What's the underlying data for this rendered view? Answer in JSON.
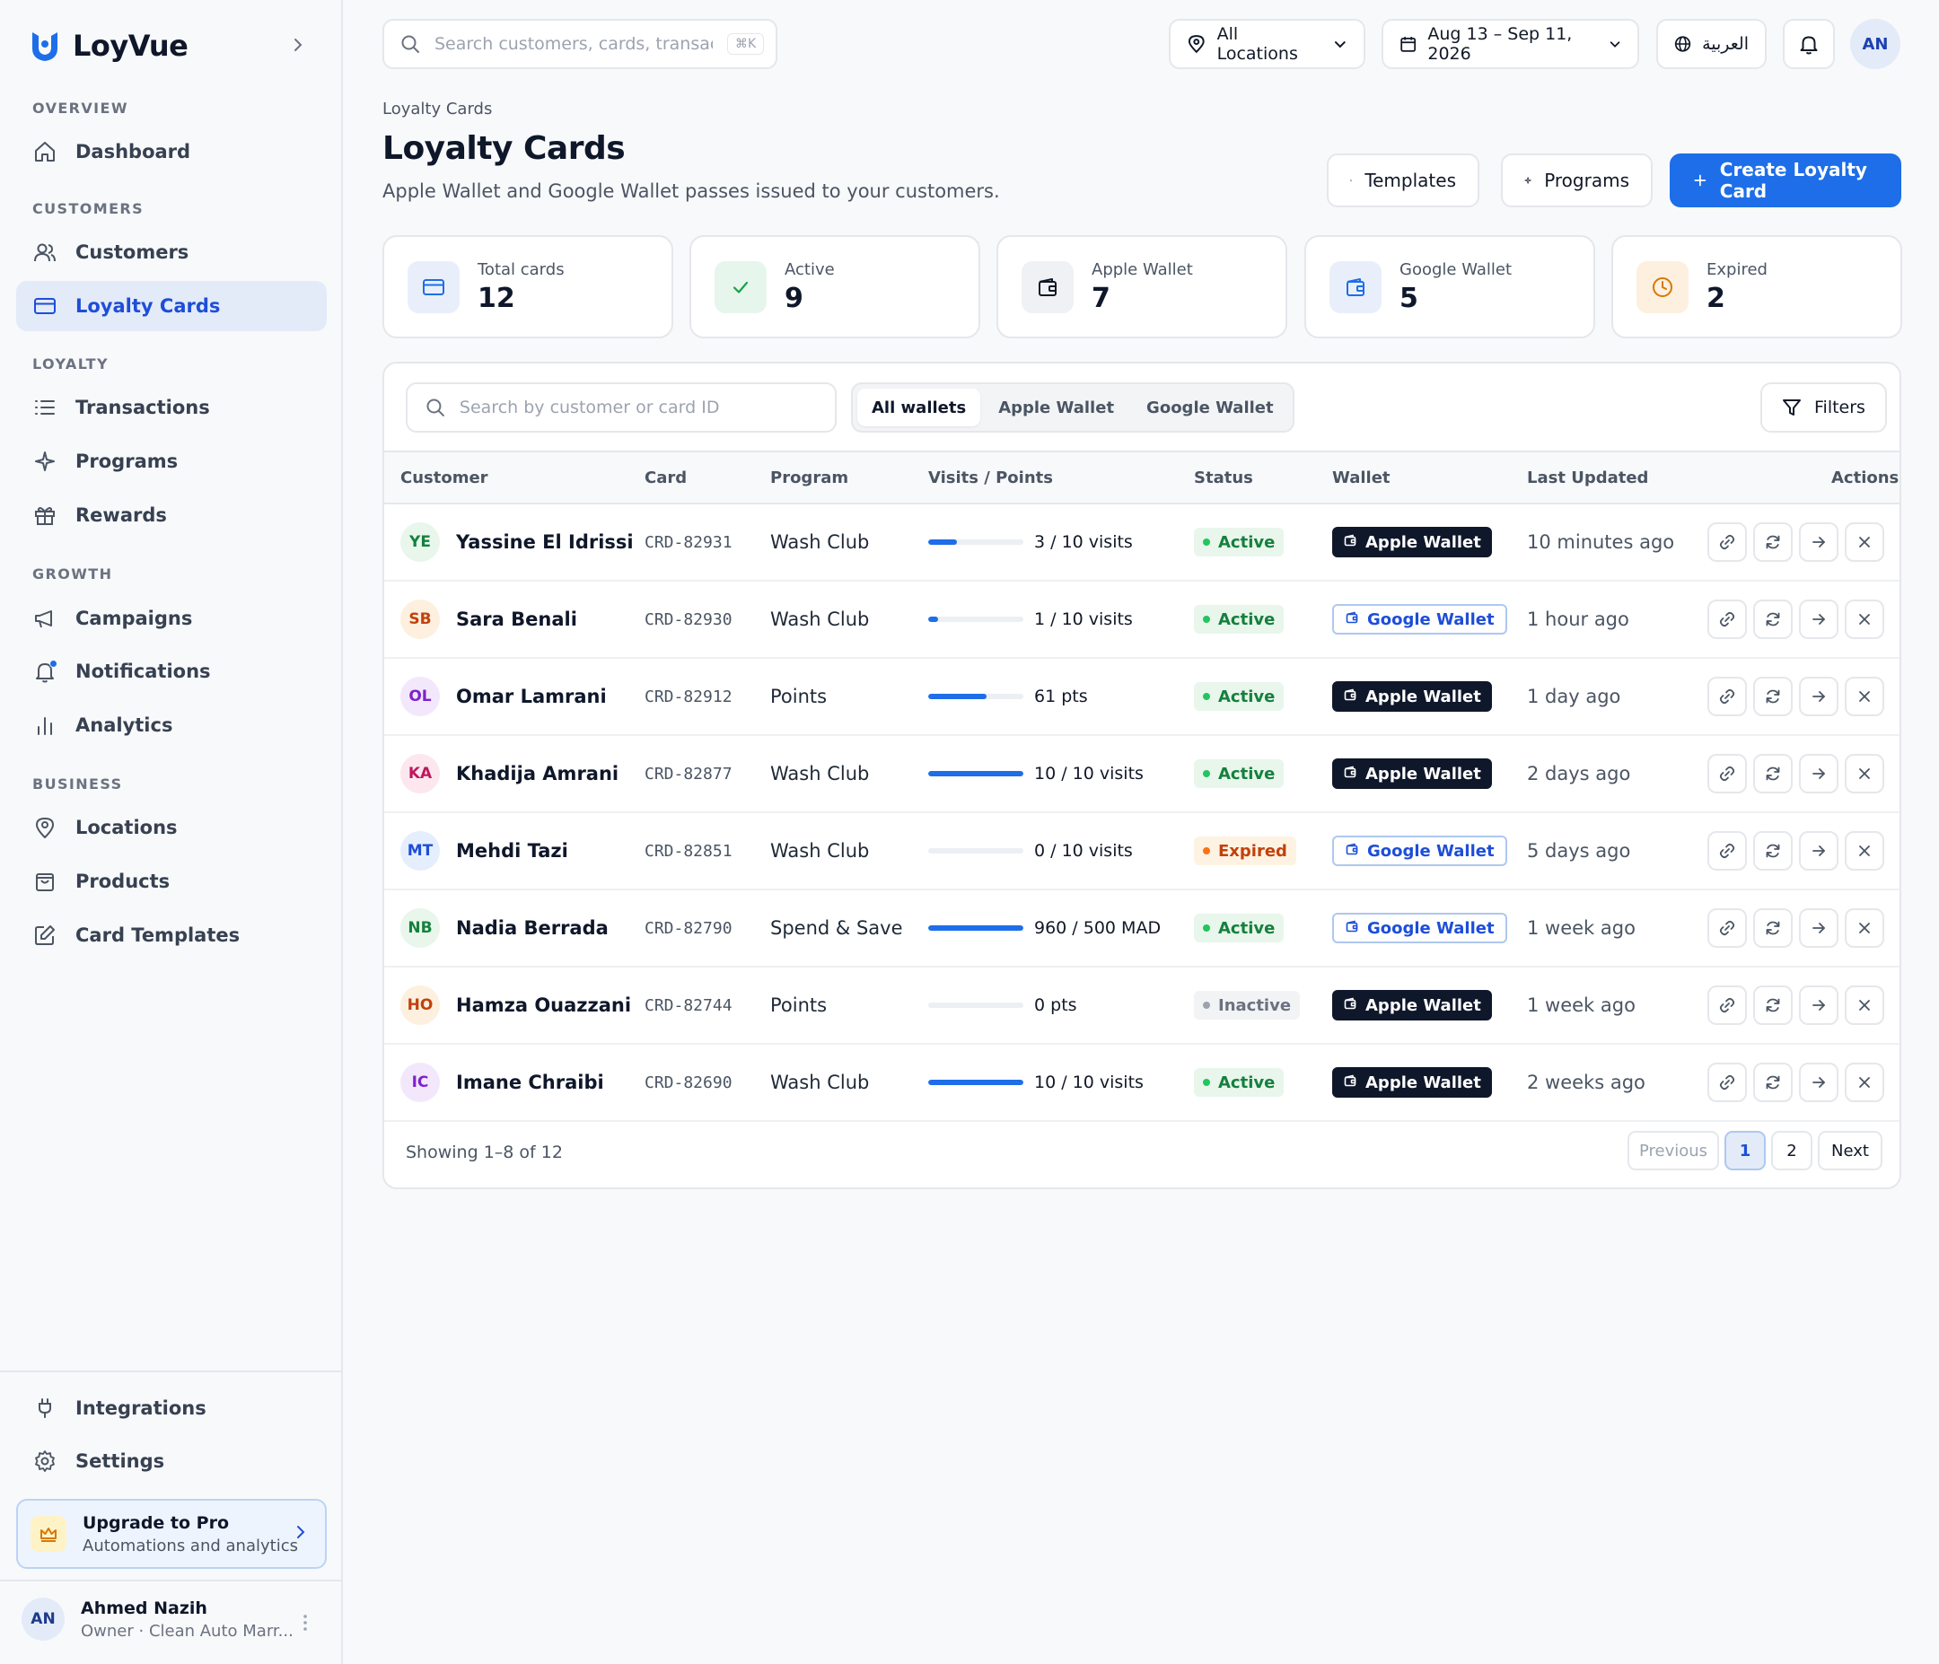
{
  "brand": {
    "name": "LoyVue"
  },
  "sidebar": {
    "sections": {
      "overview": "OVERVIEW",
      "customers": "CUSTOMERS",
      "loyalty": "LOYALTY",
      "growth": "GROWTH",
      "business": "BUSINESS"
    },
    "items": {
      "dashboard": "Dashboard",
      "customers": "Customers",
      "loyalty_cards": "Loyalty Cards",
      "transactions": "Transactions",
      "programs": "Programs",
      "rewards": "Rewards",
      "campaigns": "Campaigns",
      "notifications": "Notifications",
      "analytics": "Analytics",
      "locations": "Locations",
      "products": "Products",
      "card_templates": "Card Templates",
      "integrations": "Integrations",
      "settings": "Settings"
    },
    "active_item": "Loyalty Cards",
    "upgrade": {
      "title": "Upgrade to Pro",
      "subtitle": "Automations and analytics"
    },
    "user": {
      "initials": "AN",
      "name": "Ahmed Nazih",
      "role": "Owner · Clean Auto Marr..."
    }
  },
  "topbar": {
    "search_placeholder": "Search customers, cards, transactions",
    "shortcut": "⌘K",
    "location": "All Locations",
    "date_range": "Aug 13 – Sep 11, 2026",
    "language": "العربية",
    "avatar": "AN"
  },
  "page": {
    "breadcrumb": "Loyalty Cards",
    "title": "Loyalty Cards",
    "subtitle": "Apple Wallet and Google Wallet passes issued to your customers.",
    "templates_btn": "Templates",
    "programs_btn": "Programs",
    "create_btn": "Create Loyalty Card"
  },
  "stats": [
    {
      "label": "Total cards",
      "value": "12"
    },
    {
      "label": "Active",
      "value": "9"
    },
    {
      "label": "Apple Wallet",
      "value": "7"
    },
    {
      "label": "Google Wallet",
      "value": "5"
    },
    {
      "label": "Expired",
      "value": "2"
    }
  ],
  "table": {
    "search_placeholder": "Search by customer or card ID",
    "segments": [
      "All wallets",
      "Apple Wallet",
      "Google Wallet"
    ],
    "selected_segment": "All wallets",
    "filters_btn": "Filters",
    "columns": {
      "customer": "Customer",
      "card": "Card",
      "program": "Program",
      "visits": "Visits / Points",
      "status": "Status",
      "wallet": "Wallet",
      "updated": "Last Updated",
      "actions": "Actions"
    },
    "rows": [
      {
        "initials": "YE",
        "name": "Yassine El Idrissi",
        "card": "CRD-82931",
        "program": "Wash Club",
        "progress": 0.3,
        "visits": "3 / 10 visits",
        "status": "Active",
        "wallet": "Apple Wallet",
        "updated": "10 minutes ago"
      },
      {
        "initials": "SB",
        "name": "Sara Benali",
        "card": "CRD-82930",
        "program": "Wash Club",
        "progress": 0.1,
        "visits": "1 / 10 visits",
        "status": "Active",
        "wallet": "Google Wallet",
        "updated": "1 hour ago"
      },
      {
        "initials": "OL",
        "name": "Omar Lamrani",
        "card": "CRD-82912",
        "program": "Points",
        "progress": 0.61,
        "visits": "61 pts",
        "status": "Active",
        "wallet": "Apple Wallet",
        "updated": "1 day ago"
      },
      {
        "initials": "KA",
        "name": "Khadija Amrani",
        "card": "CRD-82877",
        "program": "Wash Club",
        "progress": 1.0,
        "visits": "10 / 10 visits",
        "status": "Active",
        "wallet": "Apple Wallet",
        "updated": "2 days ago"
      },
      {
        "initials": "MT",
        "name": "Mehdi Tazi",
        "card": "CRD-82851",
        "program": "Wash Club",
        "progress": 0.0,
        "visits": "0 / 10 visits",
        "status": "Expired",
        "wallet": "Google Wallet",
        "updated": "5 days ago"
      },
      {
        "initials": "NB",
        "name": "Nadia Berrada",
        "card": "CRD-82790",
        "program": "Spend & Save",
        "progress": 1.0,
        "visits": "960 / 500 MAD",
        "status": "Active",
        "wallet": "Google Wallet",
        "updated": "1 week ago"
      },
      {
        "initials": "HO",
        "name": "Hamza Ouazzani",
        "card": "CRD-82744",
        "program": "Points",
        "progress": 0.0,
        "visits": "0 pts",
        "status": "Inactive",
        "wallet": "Apple Wallet",
        "updated": "1 week ago"
      },
      {
        "initials": "IC",
        "name": "Imane Chraibi",
        "card": "CRD-82690",
        "program": "Wash Club",
        "progress": 1.0,
        "visits": "10 / 10 visits",
        "status": "Active",
        "wallet": "Apple Wallet",
        "updated": "2 weeks ago"
      }
    ],
    "footer": "Showing 1–8 of 12",
    "pagination": {
      "previous": "Previous",
      "pages": [
        "1",
        "2"
      ],
      "current": "1",
      "next": "Next"
    }
  },
  "colors": {
    "accent": "#1d6ee8",
    "active_bg": "#e8f6ec",
    "active_fg": "#15803d",
    "expired_bg": "#fef3e2",
    "expired_fg": "#c2410c",
    "inactive_bg": "#f1f3f5",
    "inactive_fg": "#6b7280"
  }
}
